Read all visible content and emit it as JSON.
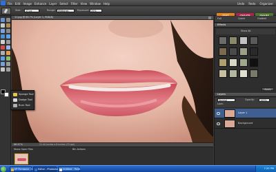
{
  "menu": {
    "items": [
      "File",
      "Edit",
      "Image",
      "Enhance",
      "Layer",
      "Select",
      "Filter",
      "View",
      "Window",
      "Help"
    ],
    "right": [
      "Undo",
      "Redo",
      "Organizer"
    ]
  },
  "options": {
    "size_label": "Size:",
    "size_value": "17 px",
    "range_label": "Range:",
    "range_value": "Midtones",
    "exposure_label": "Exposure:",
    "exposure_value": "20%"
  },
  "mode_tabs": [
    "EDIT",
    "CREATE",
    "SHARE"
  ],
  "document": {
    "title": "11.jpg @ 66.7% (Layer 1, RGB/8)",
    "zoom": "66.67%",
    "dimensions": "11.44 inches x 8 inches (72 ppi)",
    "bin_label": "Show Open Files",
    "bin_actions": "Bin Actions"
  },
  "flyout": {
    "items": [
      "Sponge Tool",
      "Dodge Tool",
      "Burn Tool"
    ]
  },
  "right_panel": {
    "fix_tabs": [
      "Full",
      "Quick",
      "Guided"
    ],
    "effects_label": "Effects",
    "show_all_label": "Show All",
    "apply_button": "Apply",
    "layers_label": "Layers",
    "blend_mode": "Normal",
    "opacity_label": "Opacity:",
    "opacity_value": "100%",
    "lock_label": "Lock:",
    "layers": [
      {
        "name": "Layer 1",
        "selected": true
      },
      {
        "name": "Background",
        "selected": false
      }
    ]
  },
  "taskbar": {
    "items": [
      "KP Firmware - Exc...",
      "Editor - Photoshop ...",
      "Untitled - Paint"
    ],
    "clock": "7:20 PM"
  }
}
